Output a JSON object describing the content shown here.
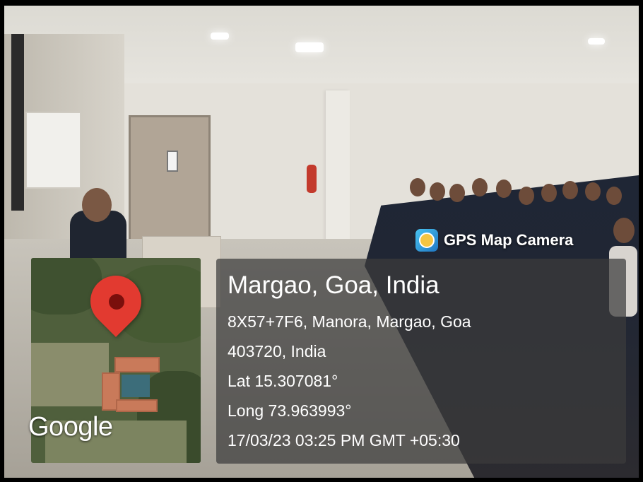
{
  "watermark": {
    "app_name": "GPS Map Camera",
    "icon": "gps-map-camera-icon"
  },
  "map": {
    "provider_label": "Google",
    "marker_icon": "location-pin-icon",
    "marker_color": "#e23a30"
  },
  "location": {
    "title": "Margao, Goa, India",
    "address_line_1": "8X57+7F6, Manora, Margao, Goa",
    "address_line_2": "403720, India",
    "latitude": "Lat 15.307081°",
    "longitude": "Long 73.963993°",
    "timestamp": "17/03/23 03:25 PM GMT +05:30"
  }
}
